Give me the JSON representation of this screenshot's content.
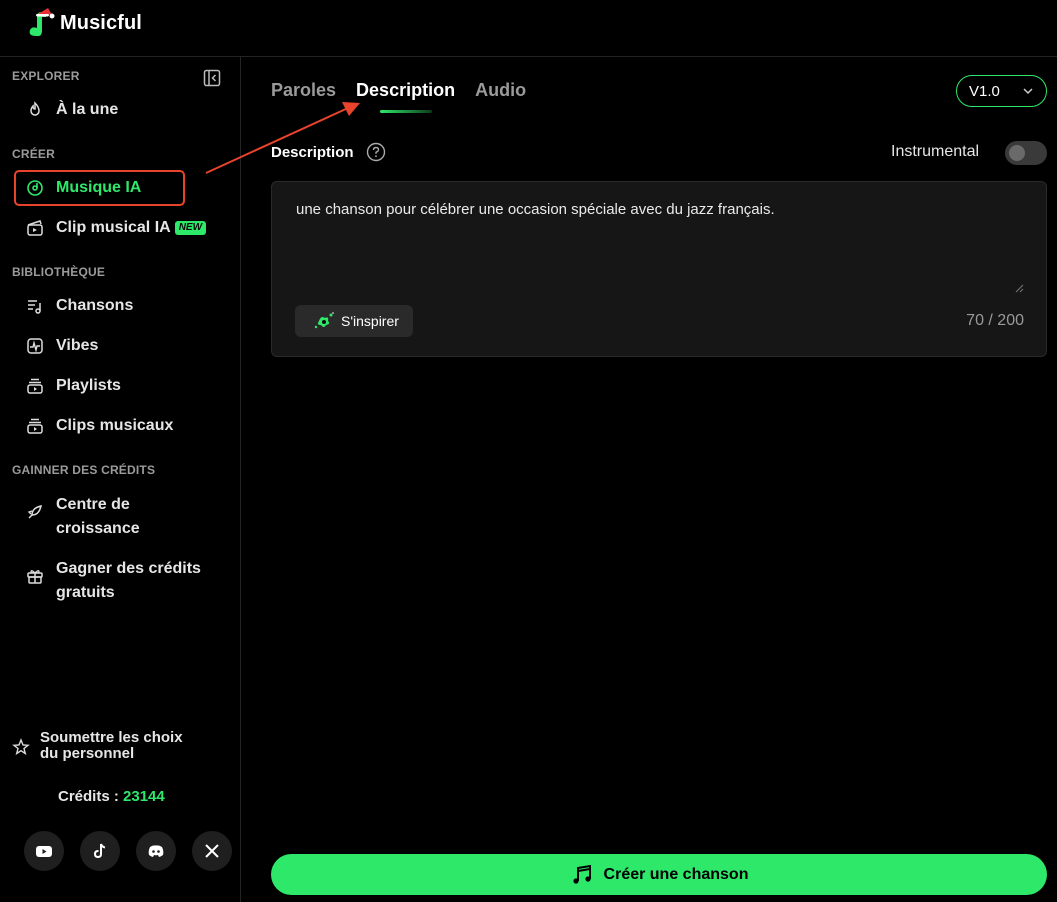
{
  "app": {
    "name": "Musicful"
  },
  "sidebar": {
    "sections": {
      "explore": "EXPLORER",
      "create": "CRÉER",
      "library": "BIBLIOTHÈQUE",
      "earn": "GAINNER DES CRÉDITS"
    },
    "items": {
      "featured": "À la une",
      "ai_music": "Musique IA",
      "ai_clip": "Clip musical IA",
      "new_badge": "NEW",
      "songs": "Chansons",
      "vibes": "Vibes",
      "playlists": "Playlists",
      "music_clips": "Clips musicaux",
      "growth_line1": "Centre de",
      "growth_line2": "croissance",
      "free_line1": "Gagner des crédits",
      "free_line2": "gratuits"
    },
    "staff_pick_line1": "Soumettre les choix",
    "staff_pick_line2": "du personnel",
    "credits_label": "Crédits :",
    "credits_value": "23144",
    "socials": [
      "youtube-icon",
      "tiktok-icon",
      "discord-icon",
      "x-icon"
    ]
  },
  "main": {
    "tabs": [
      "Paroles",
      "Description",
      "Audio"
    ],
    "active_tab": "Description",
    "version": "V1.0",
    "description_label": "Description",
    "instrumental_label": "Instrumental",
    "instrumental_on": false,
    "description_text": "une chanson pour célébrer une occasion spéciale avec du jazz français.",
    "inspire_label": "S'inspirer",
    "counter": "70 / 200",
    "create_button": "Créer une chanson"
  },
  "colors": {
    "accent": "#2ee86a",
    "annotation": "#e8432c",
    "background": "#000000"
  }
}
